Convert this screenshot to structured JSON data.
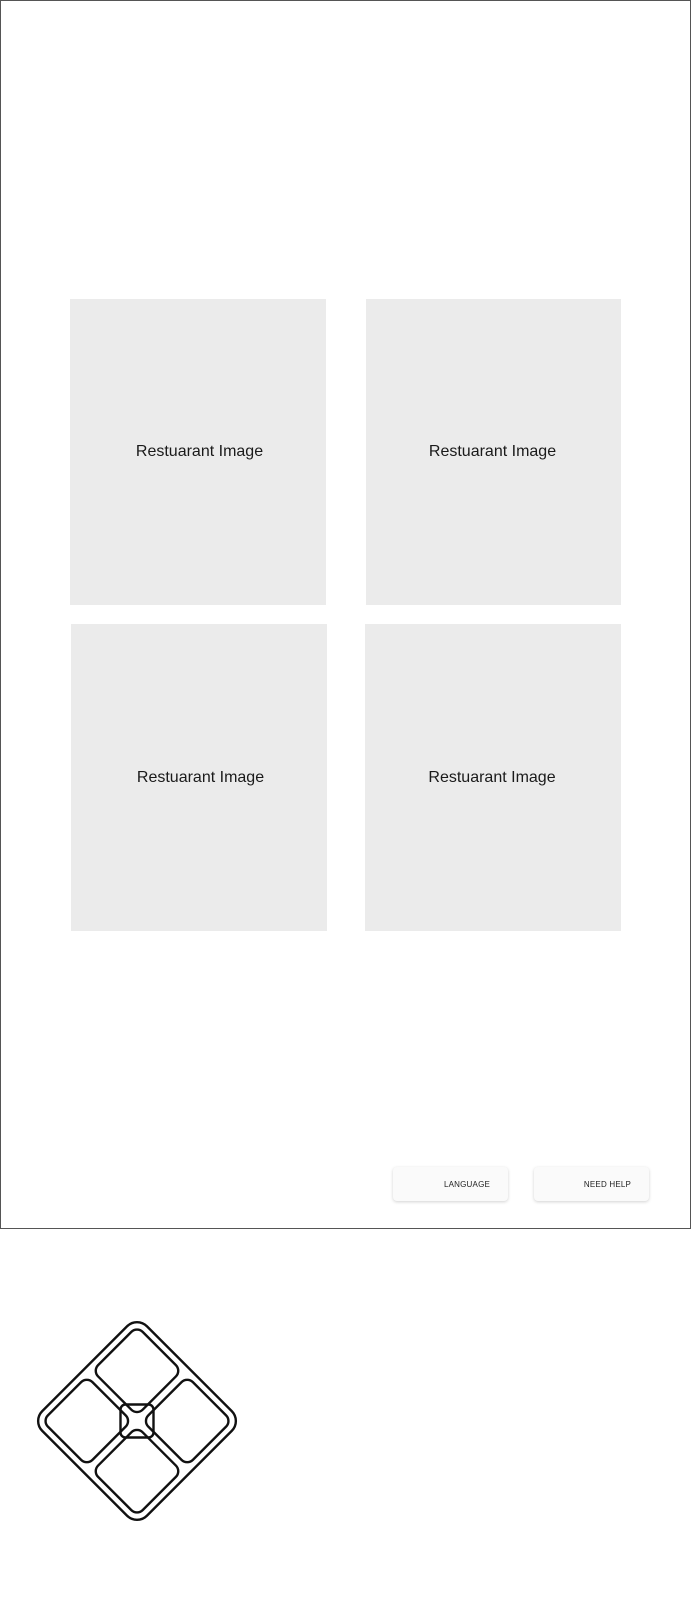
{
  "tiles": [
    {
      "label": "Restuarant Image"
    },
    {
      "label": "Restuarant Image"
    },
    {
      "label": "Restuarant Image"
    },
    {
      "label": "Restuarant Image"
    }
  ],
  "footer": {
    "language_label": "LANGUAGE",
    "need_help_label": "NEED HELP"
  },
  "icons": {
    "logo": "diamond-grid-logo-icon"
  },
  "colors": {
    "tile_background": "#ebebeb",
    "button_background": "#fafafa",
    "frame_border": "#555555",
    "logo_stroke": "#111111"
  }
}
